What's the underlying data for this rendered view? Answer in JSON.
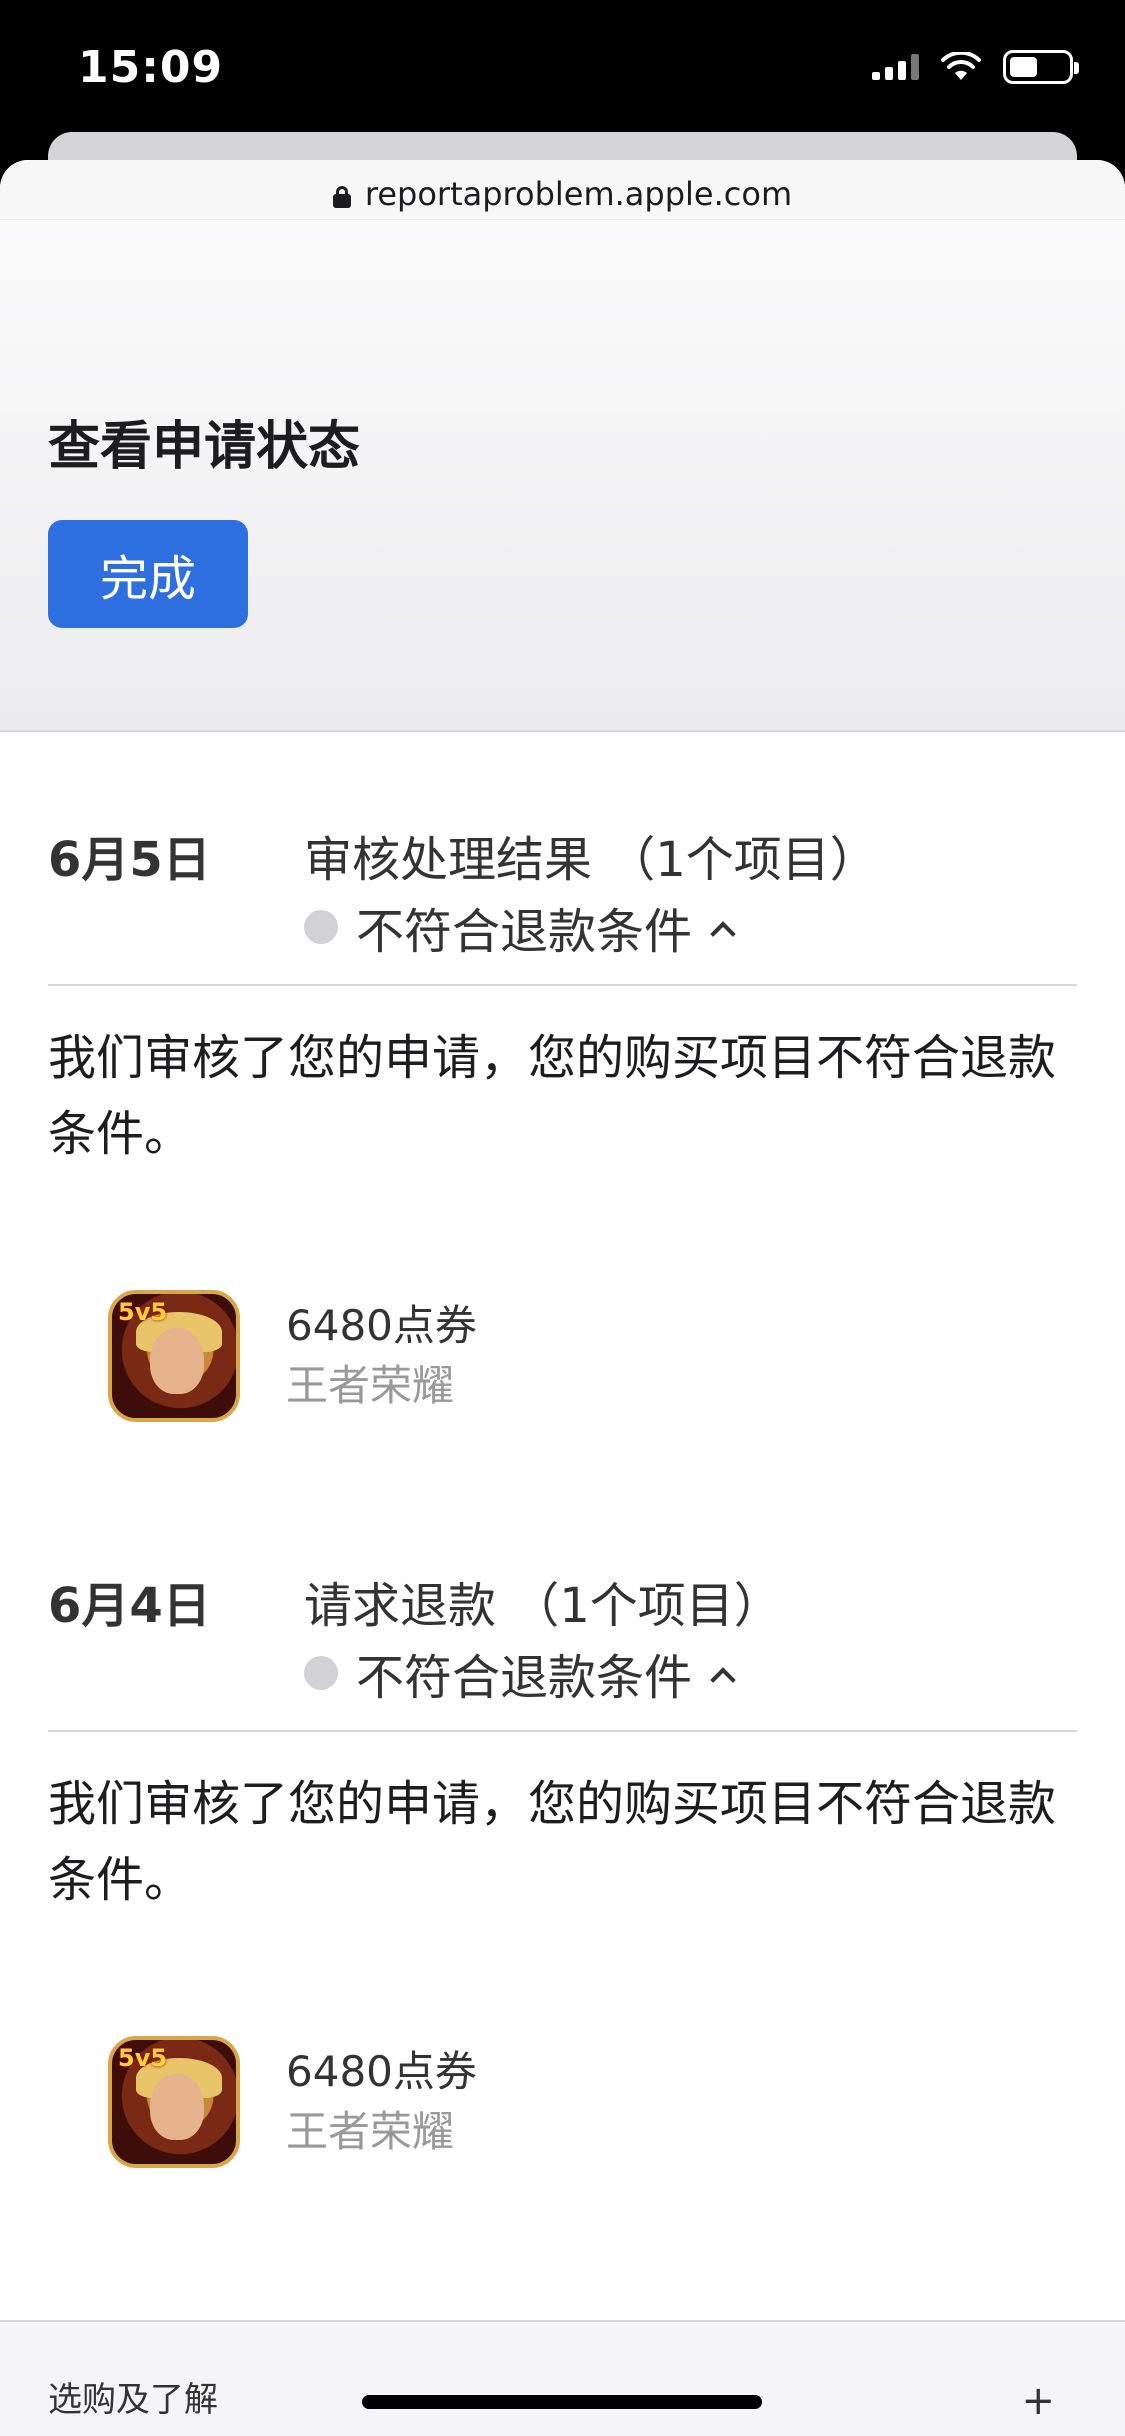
{
  "status_bar": {
    "time": "15:09",
    "battery_level": 0.48
  },
  "browser": {
    "url": "reportaproblem.apple.com"
  },
  "header": {
    "title": "查看申请状态",
    "done_label": "完成"
  },
  "entries": [
    {
      "date": "6月5日",
      "title": "审核处理结果 （1个项目）",
      "status": "不符合退款条件",
      "message": "我们审核了您的申请，您的购买项目不符合退款条件。",
      "item": {
        "name": "6480点券",
        "app": "王者荣耀",
        "icon_badge": "5v5"
      }
    },
    {
      "date": "6月4日",
      "title": "请求退款 （1个项目）",
      "status": "不符合退款条件",
      "message": "我们审核了您的申请，您的购买项目不符合退款条件。",
      "item": {
        "name": "6480点券",
        "app": "王者荣耀",
        "icon_badge": "5v5"
      }
    }
  ],
  "footer": {
    "label": "选购及了解",
    "expand_icon": "+"
  },
  "colors": {
    "accent": "#2e6fe0",
    "status_dot": "#d1d1d6"
  }
}
